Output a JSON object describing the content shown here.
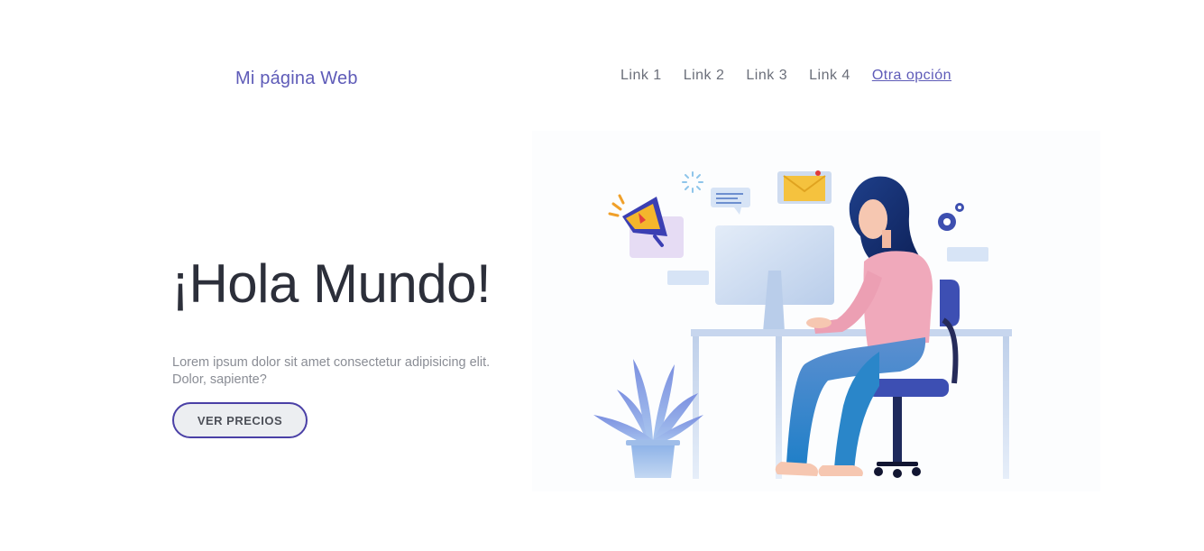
{
  "header": {
    "brand": "Mi página Web",
    "nav": [
      {
        "label": "Link 1"
      },
      {
        "label": "Link 2"
      },
      {
        "label": "Link 3"
      },
      {
        "label": "Link 4"
      },
      {
        "label": "Otra opción",
        "active": true
      }
    ]
  },
  "hero": {
    "title": "¡Hola Mundo!",
    "text": "Lorem ipsum dolor sit amet consectetur adipisicing elit. Dolor, sapiente?",
    "button": "VER PRECIOS"
  },
  "colors": {
    "accent": "#5e5bb8",
    "button_border": "#4a40a6",
    "title": "#2c2f3a"
  },
  "illustration": {
    "icons": [
      "megaphone-icon",
      "envelope-icon",
      "chat-icon",
      "loading-icon",
      "gear-icon"
    ]
  }
}
